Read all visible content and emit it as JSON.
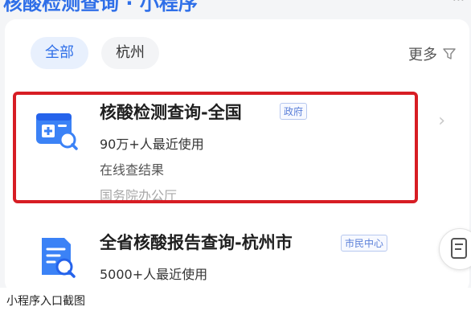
{
  "header": {
    "title": "核酸检测查询 · 小程序",
    "right_text": "..."
  },
  "filters": {
    "chips": [
      {
        "label": "全部",
        "active": true
      },
      {
        "label": "杭州",
        "active": false
      }
    ],
    "more_label": "更多"
  },
  "results": [
    {
      "title": "核酸检测查询-全国",
      "tag": "政府",
      "usage": "90万+人最近使用",
      "desc": "在线查结果",
      "org": "国务院办公厅",
      "highlighted": true
    },
    {
      "title": "全省核酸报告查询-杭州市",
      "tag": "市民中心",
      "usage": "5000+人最近使用",
      "highlighted": false
    }
  ],
  "caption": "小程序入口截图",
  "colors": {
    "accent": "#2f6fe8",
    "highlight_border": "#d71d24"
  },
  "icons": [
    "hospital-card-search-icon",
    "report-search-icon",
    "filter-icon",
    "chevron-right-icon"
  ]
}
